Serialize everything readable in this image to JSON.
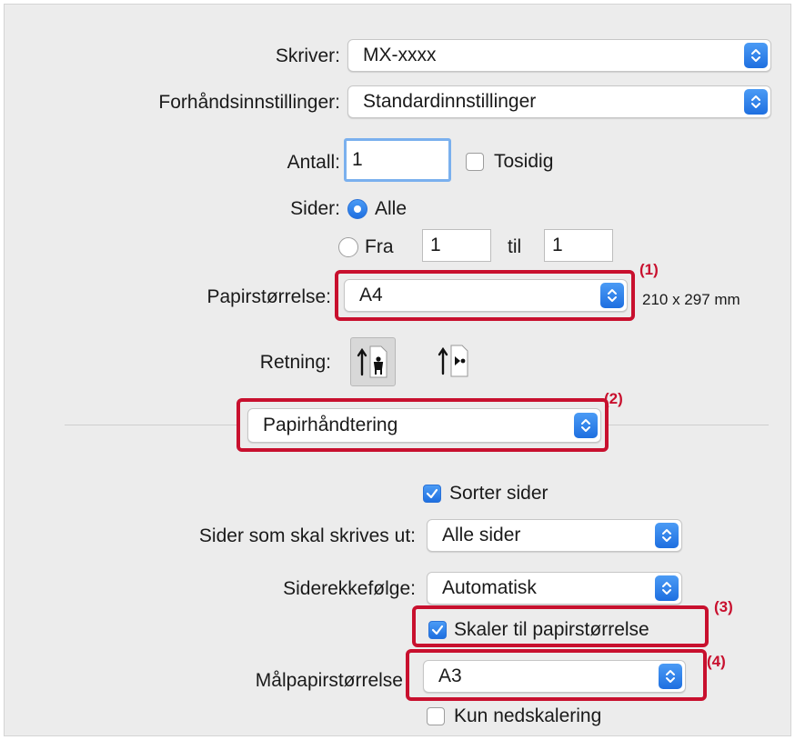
{
  "printer": {
    "label": "Skriver:",
    "value": "MX-xxxx"
  },
  "presets": {
    "label": "Forhåndsinnstillinger:",
    "value": "Standardinnstillinger"
  },
  "copies": {
    "label": "Antall:",
    "value": "1",
    "two_sided_label": "Tosidig",
    "two_sided_checked": false
  },
  "pages": {
    "label": "Sider:",
    "all_label": "Alle",
    "from_label": "Fra",
    "from_value": "1",
    "to_label": "til",
    "to_value": "1",
    "selected": "all"
  },
  "paper_size": {
    "label": "Papirstørrelse:",
    "value": "A4",
    "dimensions": "210 x 297 mm"
  },
  "orientation": {
    "label": "Retning:",
    "selected": "portrait",
    "options": [
      "portrait",
      "landscape"
    ]
  },
  "section_menu": {
    "value": "Papirhåndtering"
  },
  "collate": {
    "label": "Sorter sider",
    "checked": true
  },
  "pages_to_print": {
    "label": "Sider som skal skrives ut:",
    "value": "Alle sider"
  },
  "page_order": {
    "label": "Siderekkefølge:",
    "value": "Automatisk"
  },
  "scale_to_fit": {
    "label": "Skaler til papirstørrelse",
    "checked": true
  },
  "target_paper": {
    "label": "Målpapirstørrelse",
    "value": "A3"
  },
  "scale_down_only": {
    "label": "Kun nedskalering",
    "checked": false
  },
  "callouts": [
    "(1)",
    "(2)",
    "(3)",
    "(4)"
  ],
  "colors": {
    "accent": "#1e6fe0",
    "highlight": "#c8102e",
    "panel": "#ececec"
  },
  "icons": [
    "chevron-updown-icon",
    "checkmark-icon",
    "portrait-orientation-icon",
    "landscape-orientation-icon"
  ]
}
